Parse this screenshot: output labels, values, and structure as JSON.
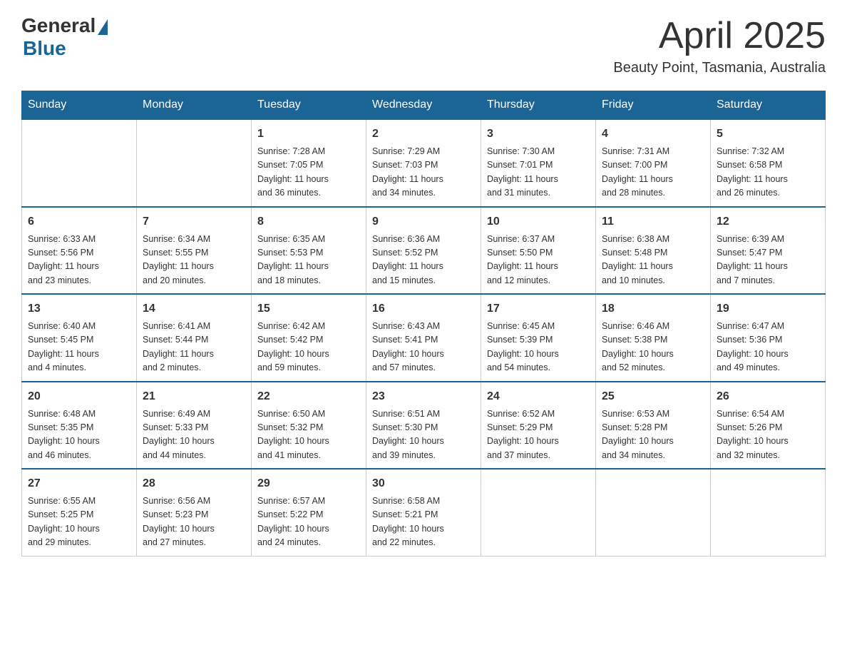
{
  "logo": {
    "general": "General",
    "blue": "Blue"
  },
  "title": "April 2025",
  "location": "Beauty Point, Tasmania, Australia",
  "headers": [
    "Sunday",
    "Monday",
    "Tuesday",
    "Wednesday",
    "Thursday",
    "Friday",
    "Saturday"
  ],
  "weeks": [
    [
      {
        "day": "",
        "info": ""
      },
      {
        "day": "",
        "info": ""
      },
      {
        "day": "1",
        "info": "Sunrise: 7:28 AM\nSunset: 7:05 PM\nDaylight: 11 hours\nand 36 minutes."
      },
      {
        "day": "2",
        "info": "Sunrise: 7:29 AM\nSunset: 7:03 PM\nDaylight: 11 hours\nand 34 minutes."
      },
      {
        "day": "3",
        "info": "Sunrise: 7:30 AM\nSunset: 7:01 PM\nDaylight: 11 hours\nand 31 minutes."
      },
      {
        "day": "4",
        "info": "Sunrise: 7:31 AM\nSunset: 7:00 PM\nDaylight: 11 hours\nand 28 minutes."
      },
      {
        "day": "5",
        "info": "Sunrise: 7:32 AM\nSunset: 6:58 PM\nDaylight: 11 hours\nand 26 minutes."
      }
    ],
    [
      {
        "day": "6",
        "info": "Sunrise: 6:33 AM\nSunset: 5:56 PM\nDaylight: 11 hours\nand 23 minutes."
      },
      {
        "day": "7",
        "info": "Sunrise: 6:34 AM\nSunset: 5:55 PM\nDaylight: 11 hours\nand 20 minutes."
      },
      {
        "day": "8",
        "info": "Sunrise: 6:35 AM\nSunset: 5:53 PM\nDaylight: 11 hours\nand 18 minutes."
      },
      {
        "day": "9",
        "info": "Sunrise: 6:36 AM\nSunset: 5:52 PM\nDaylight: 11 hours\nand 15 minutes."
      },
      {
        "day": "10",
        "info": "Sunrise: 6:37 AM\nSunset: 5:50 PM\nDaylight: 11 hours\nand 12 minutes."
      },
      {
        "day": "11",
        "info": "Sunrise: 6:38 AM\nSunset: 5:48 PM\nDaylight: 11 hours\nand 10 minutes."
      },
      {
        "day": "12",
        "info": "Sunrise: 6:39 AM\nSunset: 5:47 PM\nDaylight: 11 hours\nand 7 minutes."
      }
    ],
    [
      {
        "day": "13",
        "info": "Sunrise: 6:40 AM\nSunset: 5:45 PM\nDaylight: 11 hours\nand 4 minutes."
      },
      {
        "day": "14",
        "info": "Sunrise: 6:41 AM\nSunset: 5:44 PM\nDaylight: 11 hours\nand 2 minutes."
      },
      {
        "day": "15",
        "info": "Sunrise: 6:42 AM\nSunset: 5:42 PM\nDaylight: 10 hours\nand 59 minutes."
      },
      {
        "day": "16",
        "info": "Sunrise: 6:43 AM\nSunset: 5:41 PM\nDaylight: 10 hours\nand 57 minutes."
      },
      {
        "day": "17",
        "info": "Sunrise: 6:45 AM\nSunset: 5:39 PM\nDaylight: 10 hours\nand 54 minutes."
      },
      {
        "day": "18",
        "info": "Sunrise: 6:46 AM\nSunset: 5:38 PM\nDaylight: 10 hours\nand 52 minutes."
      },
      {
        "day": "19",
        "info": "Sunrise: 6:47 AM\nSunset: 5:36 PM\nDaylight: 10 hours\nand 49 minutes."
      }
    ],
    [
      {
        "day": "20",
        "info": "Sunrise: 6:48 AM\nSunset: 5:35 PM\nDaylight: 10 hours\nand 46 minutes."
      },
      {
        "day": "21",
        "info": "Sunrise: 6:49 AM\nSunset: 5:33 PM\nDaylight: 10 hours\nand 44 minutes."
      },
      {
        "day": "22",
        "info": "Sunrise: 6:50 AM\nSunset: 5:32 PM\nDaylight: 10 hours\nand 41 minutes."
      },
      {
        "day": "23",
        "info": "Sunrise: 6:51 AM\nSunset: 5:30 PM\nDaylight: 10 hours\nand 39 minutes."
      },
      {
        "day": "24",
        "info": "Sunrise: 6:52 AM\nSunset: 5:29 PM\nDaylight: 10 hours\nand 37 minutes."
      },
      {
        "day": "25",
        "info": "Sunrise: 6:53 AM\nSunset: 5:28 PM\nDaylight: 10 hours\nand 34 minutes."
      },
      {
        "day": "26",
        "info": "Sunrise: 6:54 AM\nSunset: 5:26 PM\nDaylight: 10 hours\nand 32 minutes."
      }
    ],
    [
      {
        "day": "27",
        "info": "Sunrise: 6:55 AM\nSunset: 5:25 PM\nDaylight: 10 hours\nand 29 minutes."
      },
      {
        "day": "28",
        "info": "Sunrise: 6:56 AM\nSunset: 5:23 PM\nDaylight: 10 hours\nand 27 minutes."
      },
      {
        "day": "29",
        "info": "Sunrise: 6:57 AM\nSunset: 5:22 PM\nDaylight: 10 hours\nand 24 minutes."
      },
      {
        "day": "30",
        "info": "Sunrise: 6:58 AM\nSunset: 5:21 PM\nDaylight: 10 hours\nand 22 minutes."
      },
      {
        "day": "",
        "info": ""
      },
      {
        "day": "",
        "info": ""
      },
      {
        "day": "",
        "info": ""
      }
    ]
  ]
}
